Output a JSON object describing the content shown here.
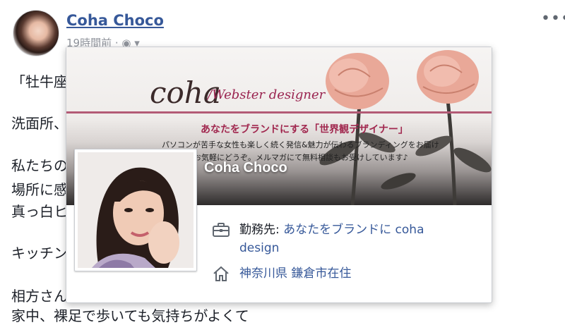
{
  "post": {
    "author": "Coha Choco",
    "timestamp": "19時間前",
    "more_label": "•••",
    "lines": [
      "「牡牛座",
      "洗面所、",
      "私たちの",
      "場所に感",
      "真っ白ヒ",
      "キッチン",
      "相方さん",
      "家中、裸足で歩いても気持ちがよくて"
    ]
  },
  "hover_card": {
    "cover": {
      "logo": "coha",
      "logo_sub": "/Webster designer",
      "slogan": "あなたをブランドにする「世界観デザイナー」",
      "desc_line1": "パソコンが苦手な女性も楽しく続く発信&魅力が伝わるブランディングをお届け",
      "desc_line2": "お気軽にどうぞ。メルマガにて無料相談もお受けしています♪"
    },
    "name": "Coha Choco",
    "work_label": "勤務先:",
    "work_value_line1": "あなたをブランドに coha",
    "work_value_line2": "design",
    "lives_in": "神奈川県 鎌倉市在住"
  },
  "icons": {
    "briefcase": "briefcase-icon",
    "home": "home-icon",
    "globe": "globe-icon",
    "more": "more-icon"
  },
  "colors": {
    "link_blue": "#365899",
    "text": "#1d2129",
    "meta_gray": "#90949c",
    "brand_pink": "#a1284f"
  }
}
